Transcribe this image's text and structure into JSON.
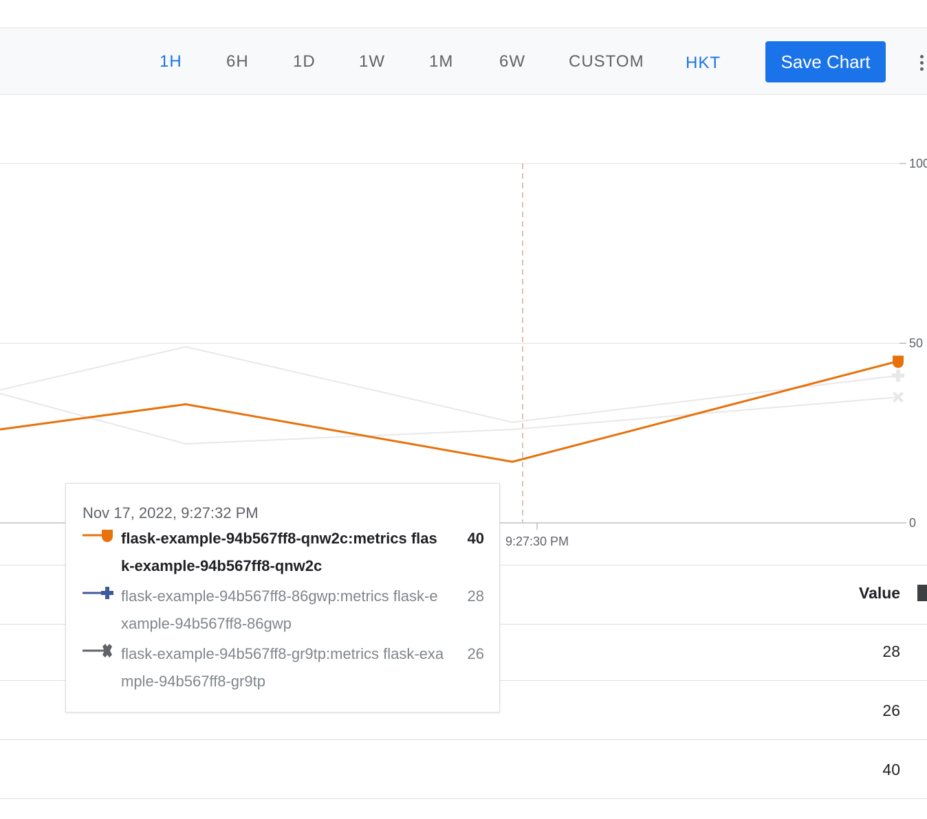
{
  "toolbar": {
    "ranges": [
      "1H",
      "6H",
      "1D",
      "1W",
      "1M",
      "6W",
      "CUSTOM"
    ],
    "active_range": "1H",
    "timezone": "HKT",
    "save_label": "Save Chart",
    "more_icon": "more-vert-icon"
  },
  "colors": {
    "accent": "#1a73e8",
    "series_highlight": "#e8710a",
    "series_muted": "#e8e8e8",
    "crosshair": "#d7c1b4"
  },
  "chart_data": {
    "type": "line",
    "y_ticks": [
      "100",
      "50",
      "0"
    ],
    "ylim": [
      0,
      100
    ],
    "x_tick": "9:27:30 PM",
    "y_axis_side": "right",
    "grid": true,
    "series": [
      {
        "name": "flask-example-94b567ff8-qnw2c:metrics flask-example-94b567ff8-qnw2c",
        "marker": "shield",
        "highlighted": true,
        "points": [
          [
            0,
            26
          ],
          [
            1,
            33
          ],
          [
            2,
            17
          ],
          [
            3,
            45
          ]
        ]
      },
      {
        "name": "flask-example-94b567ff8-86gwp:metrics flask-example-94b567ff8-86gwp",
        "marker": "plus",
        "highlighted": false,
        "points": [
          [
            0,
            37
          ],
          [
            1,
            49
          ],
          [
            2,
            28
          ],
          [
            3,
            41
          ]
        ]
      },
      {
        "name": "flask-example-94b567ff8-gr9tp:metrics flask-example-94b567ff8-gr9tp",
        "marker": "cross",
        "highlighted": false,
        "points": [
          [
            0,
            36
          ],
          [
            1,
            22
          ],
          [
            2,
            26
          ],
          [
            3,
            35
          ]
        ]
      }
    ]
  },
  "tooltip": {
    "timestamp": "Nov 17, 2022, 9:27:32 PM",
    "rows": [
      {
        "name": "flask-example-94b567ff8-qnw2c:metrics flask-example-94b567ff8-qnw2c",
        "value": "40",
        "marker": "shield",
        "color": "#e8710a"
      },
      {
        "name": "flask-example-94b567ff8-86gwp:metrics flask-example-94b567ff8-86gwp",
        "value": "28",
        "marker": "plus",
        "color": "#3f5a9c"
      },
      {
        "name": "flask-example-94b567ff8-gr9tp:metrics flask-example-94b567ff8-gr9tp",
        "value": "26",
        "marker": "cross",
        "color": "#5f6368"
      }
    ]
  },
  "table": {
    "value_header": "Value",
    "values": [
      "28",
      "26",
      "40"
    ]
  }
}
